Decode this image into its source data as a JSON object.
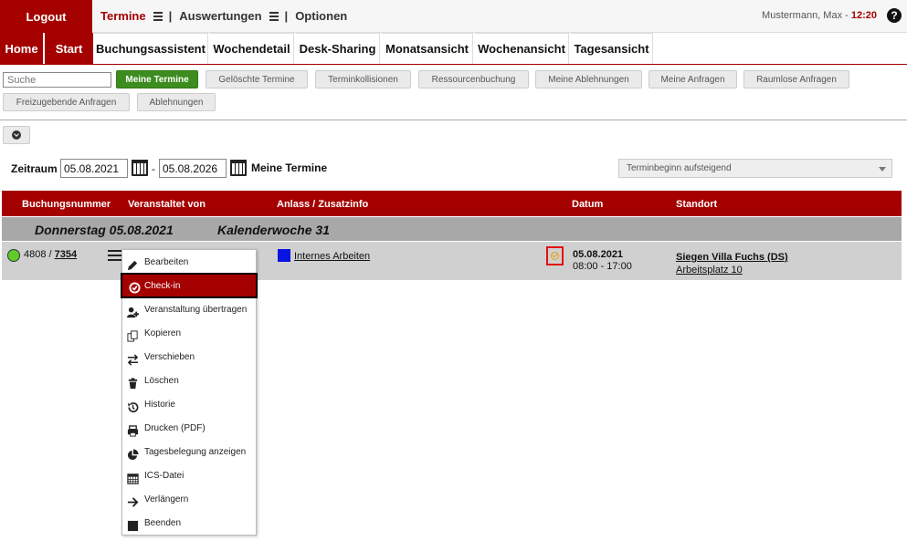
{
  "topbar": {
    "logout": "Logout",
    "nav": [
      {
        "label": "Termine",
        "active": true
      },
      {
        "label": "Auswertungen",
        "active": false
      },
      {
        "label": "Optionen",
        "active": false
      }
    ],
    "user": "Mustermann, Max - ",
    "time": "12:20",
    "help": "?"
  },
  "tabs": [
    "Home",
    "Start",
    "Buchungsassistent",
    "Wochendetail",
    "Desk-Sharing",
    "Monatsansicht",
    "Wochenansicht",
    "Tagesansicht"
  ],
  "search": {
    "placeholder": "Suche",
    "value": ""
  },
  "filters": [
    "Meine Termine",
    "Gelöschte Termine",
    "Terminkollisionen",
    "Ressourcenbuchung",
    "Meine Ablehnungen",
    "Meine Anfragen",
    "Raumlose Anfragen",
    "Freizugebende Anfragen",
    "Ablehnungen"
  ],
  "zeitraum": {
    "label": "Zeitraum",
    "from": "05.08.2021",
    "to": "05.08.2026",
    "dash": "-",
    "title": "Meine Termine",
    "sort": "Terminbeginn aufsteigend"
  },
  "table": {
    "headers": [
      "Buchungsnummer",
      "Veranstaltet von",
      "Anlass / Zusatzinfo",
      "Datum",
      "Standort"
    ],
    "day": "Donnerstag 05.08.2021",
    "week": "Kalenderwoche 31",
    "row": {
      "status_color": "#5fcc28",
      "number_prefix": "4808 / ",
      "number_link": "7354",
      "anlass_color": "#0a14e0",
      "anlass": "Internes Arbeiten",
      "date": "05.08.2021",
      "time": "08:00 - 17:00",
      "location": "Siegen Villa Fuchs (DS)",
      "place": "Arbeitsplatz 10"
    }
  },
  "context_menu": [
    {
      "label": "Bearbeiten",
      "icon": "pencil-icon"
    },
    {
      "label": "Check-in",
      "icon": "check-circle-icon",
      "active": true
    },
    {
      "label": "Veranstaltung übertragen",
      "icon": "user-plus-icon"
    },
    {
      "label": "Kopieren",
      "icon": "copy-icon"
    },
    {
      "label": "Verschieben",
      "icon": "exchange-icon"
    },
    {
      "label": "Löschen",
      "icon": "trash-icon"
    },
    {
      "label": "Historie",
      "icon": "history-icon"
    },
    {
      "label": "Drucken (PDF)",
      "icon": "print-icon"
    },
    {
      "label": "Tagesbelegung anzeigen",
      "icon": "pie-chart-icon"
    },
    {
      "label": "ICS-Datei",
      "icon": "calendar-icon"
    },
    {
      "label": "Verlängern",
      "icon": "arrow-right-icon"
    },
    {
      "label": "Beenden",
      "icon": "stop-icon"
    }
  ]
}
